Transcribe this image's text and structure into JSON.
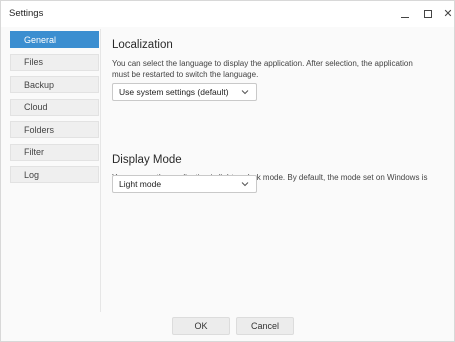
{
  "window": {
    "title": "Settings"
  },
  "sidebar": {
    "items": [
      {
        "label": "General",
        "active": true
      },
      {
        "label": "Files",
        "active": false
      },
      {
        "label": "Backup",
        "active": false
      },
      {
        "label": "Cloud",
        "active": false
      },
      {
        "label": "Folders",
        "active": false
      },
      {
        "label": "Filter",
        "active": false
      },
      {
        "label": "Log",
        "active": false
      }
    ]
  },
  "localization": {
    "title": "Localization",
    "description": "You can select the language to display the application. After selection, the application must be restarted to switch the language.",
    "selected": "Use system settings (default)"
  },
  "display_mode": {
    "title": "Display Mode",
    "description": "You can run the application in light or dark mode. By default, the mode set on Windows is used.",
    "selected": "Light mode"
  },
  "footer": {
    "ok_label": "OK",
    "cancel_label": "Cancel"
  },
  "colors": {
    "accent": "#3b8ed0",
    "nav_bg": "#efefef",
    "window_bg": "#fafafa"
  },
  "icons": {
    "minimize": "minimize-icon",
    "maximize": "maximize-icon",
    "close": "close-icon",
    "dropdown": "chevron-down-icon"
  }
}
